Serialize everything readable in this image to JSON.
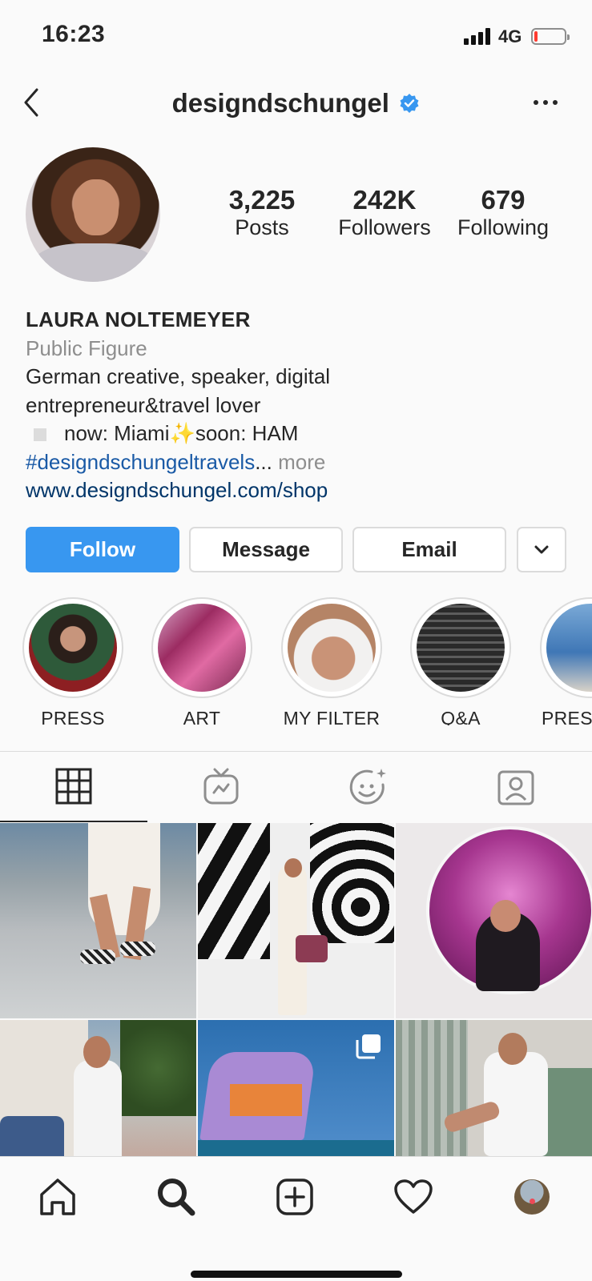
{
  "status_bar": {
    "time": "16:23",
    "network": "4G"
  },
  "header": {
    "username": "designdschungel"
  },
  "profile": {
    "stats": [
      {
        "value": "3,225",
        "label": "Posts"
      },
      {
        "value": "242K",
        "label": "Followers"
      },
      {
        "value": "679",
        "label": "Following"
      }
    ],
    "name": "LAURA NOLTEMEYER",
    "category": "Public Figure",
    "bio_line1": "German creative, speaker, digital",
    "bio_line2": "entrepreneur&travel lover",
    "bio_line3": "now: Miami✨soon: HAM",
    "hashtag": "#designdschungeltravels",
    "ellipsis": "...",
    "more": "more",
    "website": "www.designdschungel.com/shop"
  },
  "actions": {
    "follow": "Follow",
    "message": "Message",
    "email": "Email"
  },
  "highlights": [
    {
      "label": "PRESS"
    },
    {
      "label": "ART"
    },
    {
      "label": "MY FILTER"
    },
    {
      "label": "Q&A"
    },
    {
      "label": "PRESS"
    }
  ],
  "tabs": [
    {
      "icon": "grid-icon",
      "active": true
    },
    {
      "icon": "igtv-icon",
      "active": false
    },
    {
      "icon": "face-filter-icon",
      "active": false
    },
    {
      "icon": "tagged-icon",
      "active": false
    }
  ],
  "grid_posts": [
    {
      "id": "post-1",
      "multiple": false
    },
    {
      "id": "post-2",
      "multiple": false
    },
    {
      "id": "post-3",
      "multiple": false
    },
    {
      "id": "post-4",
      "multiple": false
    },
    {
      "id": "post-5",
      "multiple": true
    },
    {
      "id": "post-6",
      "multiple": false
    }
  ],
  "bottom_nav": [
    {
      "icon": "home-icon"
    },
    {
      "icon": "search-icon"
    },
    {
      "icon": "add-post-icon"
    },
    {
      "icon": "heart-icon"
    },
    {
      "icon": "profile-avatar"
    }
  ],
  "colors": {
    "accent": "#3897f0",
    "link": "#003569",
    "muted": "#8e8e8e",
    "battery_low": "#ff3b30",
    "notification_dot": "#ed4956"
  }
}
